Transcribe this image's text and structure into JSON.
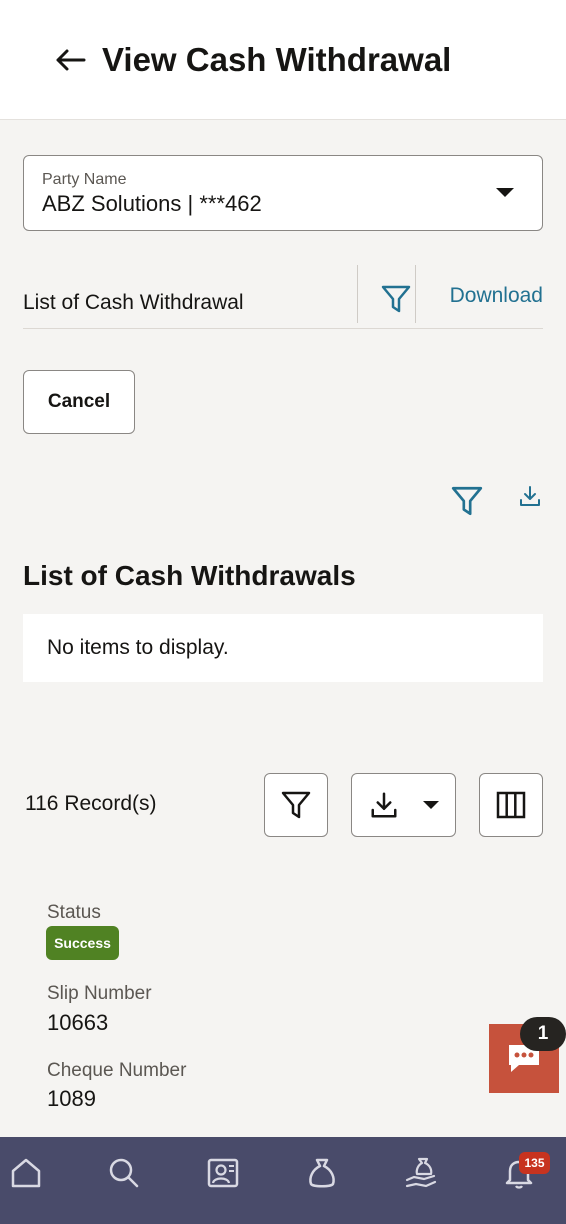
{
  "header": {
    "title": "View Cash Withdrawal",
    "back_icon": "arrow-left-icon"
  },
  "party": {
    "label": "Party Name",
    "value": "ABZ Solutions | ***462"
  },
  "list_header": {
    "title": "List of Cash Withdrawal",
    "download_label": "Download"
  },
  "actions": {
    "cancel_label": "Cancel"
  },
  "section": {
    "title": "List of Cash Withdrawals",
    "empty_message": "No items to display."
  },
  "table_toolbar": {
    "records_text": "116 Record(s)"
  },
  "record": {
    "status_label": "Status",
    "status_value": "Success",
    "slip_label": "Slip Number",
    "slip_value": "10663",
    "cheque_label": "Cheque Number",
    "cheque_value": "1089"
  },
  "chat": {
    "unread_count": "1"
  },
  "bottom_nav": {
    "items": [
      "home-icon",
      "search-icon",
      "profile-card-icon",
      "money-bag-icon",
      "hand-money-icon",
      "bell-icon"
    ],
    "notification_count": "135"
  },
  "colors": {
    "accent": "#227191",
    "success": "#508223",
    "chat": "#c6523c",
    "nav": "#494b6a",
    "badge": "#c7331f"
  }
}
